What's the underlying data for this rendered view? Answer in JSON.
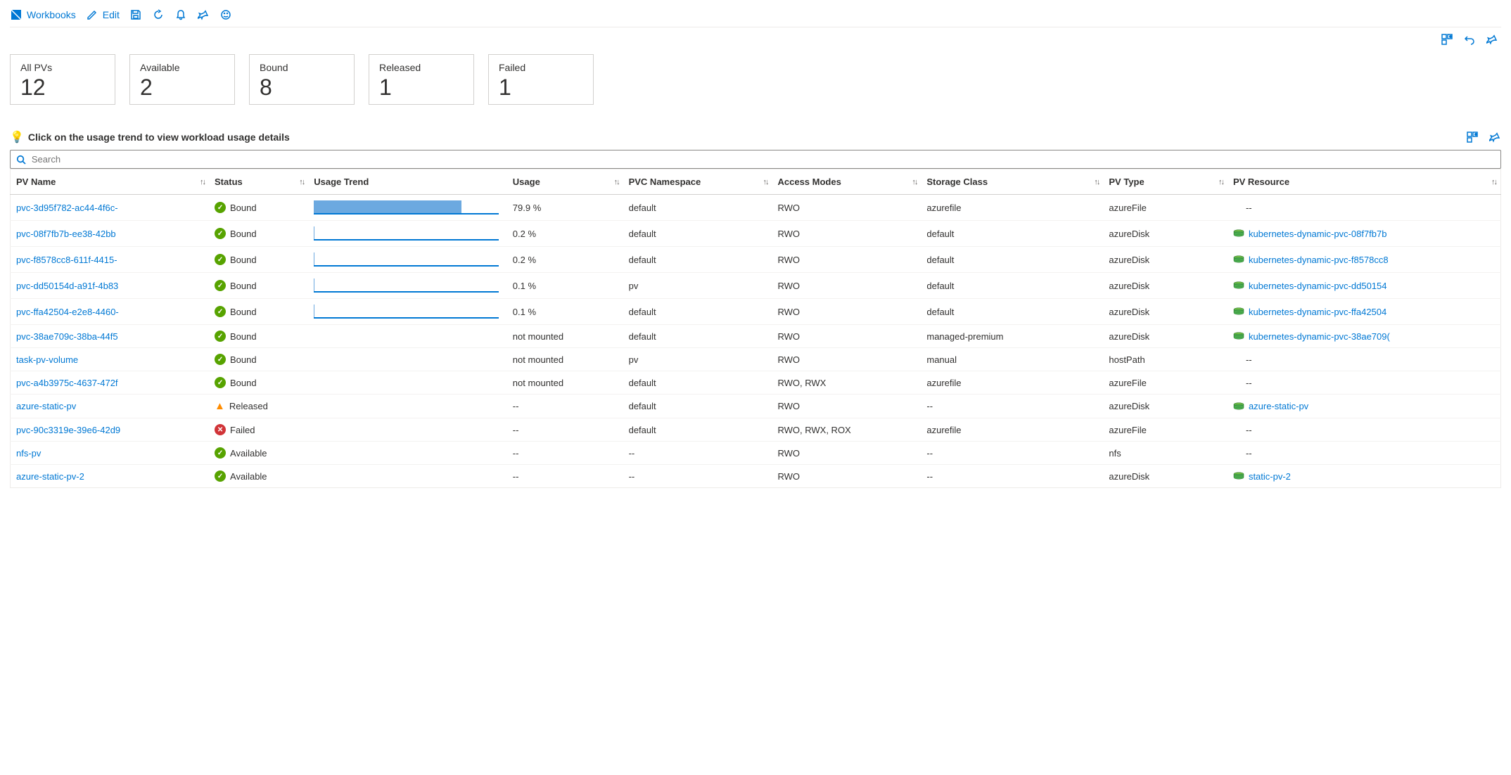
{
  "toolbar": {
    "workbooks": "Workbooks",
    "edit": "Edit"
  },
  "tiles": [
    {
      "label": "All PVs",
      "value": "12"
    },
    {
      "label": "Available",
      "value": "2"
    },
    {
      "label": "Bound",
      "value": "8"
    },
    {
      "label": "Released",
      "value": "1"
    },
    {
      "label": "Failed",
      "value": "1"
    }
  ],
  "hint": "Click on the usage trend to view workload usage details",
  "search": {
    "placeholder": "Search"
  },
  "columns": {
    "name": "PV Name",
    "status": "Status",
    "trend": "Usage Trend",
    "usage": "Usage",
    "ns": "PVC Namespace",
    "access": "Access Modes",
    "sc": "Storage Class",
    "type": "PV Type",
    "res": "PV Resource"
  },
  "rows": [
    {
      "name": "pvc-3d95f782-ac44-4f6c-",
      "status": "Bound",
      "statusKind": "ok",
      "trend": 79.9,
      "usage": "79.9 %",
      "ns": "default",
      "access": "RWO",
      "sc": "azurefile",
      "type": "azureFile",
      "res": "--",
      "resLink": false
    },
    {
      "name": "pvc-08f7fb7b-ee38-42bb",
      "status": "Bound",
      "statusKind": "ok",
      "trend": 0.2,
      "usage": "0.2 %",
      "ns": "default",
      "access": "RWO",
      "sc": "default",
      "type": "azureDisk",
      "res": "kubernetes-dynamic-pvc-08f7fb7b",
      "resLink": true
    },
    {
      "name": "pvc-f8578cc8-611f-4415-",
      "status": "Bound",
      "statusKind": "ok",
      "trend": 0.2,
      "usage": "0.2 %",
      "ns": "default",
      "access": "RWO",
      "sc": "default",
      "type": "azureDisk",
      "res": "kubernetes-dynamic-pvc-f8578cc8",
      "resLink": true
    },
    {
      "name": "pvc-dd50154d-a91f-4b83",
      "status": "Bound",
      "statusKind": "ok",
      "trend": 0.1,
      "usage": "0.1 %",
      "ns": "pv",
      "access": "RWO",
      "sc": "default",
      "type": "azureDisk",
      "res": "kubernetes-dynamic-pvc-dd50154",
      "resLink": true
    },
    {
      "name": "pvc-ffa42504-e2e8-4460-",
      "status": "Bound",
      "statusKind": "ok",
      "trend": 0.1,
      "usage": "0.1 %",
      "ns": "default",
      "access": "RWO",
      "sc": "default",
      "type": "azureDisk",
      "res": "kubernetes-dynamic-pvc-ffa42504",
      "resLink": true
    },
    {
      "name": "pvc-38ae709c-38ba-44f5",
      "status": "Bound",
      "statusKind": "ok",
      "trend": null,
      "usage": "not mounted",
      "ns": "default",
      "access": "RWO",
      "sc": "managed-premium",
      "type": "azureDisk",
      "res": "kubernetes-dynamic-pvc-38ae709(",
      "resLink": true
    },
    {
      "name": "task-pv-volume",
      "status": "Bound",
      "statusKind": "ok",
      "trend": null,
      "usage": "not mounted",
      "ns": "pv",
      "access": "RWO",
      "sc": "manual",
      "type": "hostPath",
      "res": "--",
      "resLink": false
    },
    {
      "name": "pvc-a4b3975c-4637-472f",
      "status": "Bound",
      "statusKind": "ok",
      "trend": null,
      "usage": "not mounted",
      "ns": "default",
      "access": "RWO, RWX",
      "sc": "azurefile",
      "type": "azureFile",
      "res": "--",
      "resLink": false
    },
    {
      "name": "azure-static-pv",
      "status": "Released",
      "statusKind": "warn",
      "trend": null,
      "usage": "--",
      "ns": "default",
      "access": "RWO",
      "sc": "--",
      "type": "azureDisk",
      "res": "azure-static-pv",
      "resLink": true
    },
    {
      "name": "pvc-90c3319e-39e6-42d9",
      "status": "Failed",
      "statusKind": "fail",
      "trend": null,
      "usage": "--",
      "ns": "default",
      "access": "RWO, RWX, ROX",
      "sc": "azurefile",
      "type": "azureFile",
      "res": "--",
      "resLink": false
    },
    {
      "name": "nfs-pv",
      "status": "Available",
      "statusKind": "ok",
      "trend": null,
      "usage": "--",
      "ns": "--",
      "access": "RWO",
      "sc": "--",
      "type": "nfs",
      "res": "--",
      "resLink": false
    },
    {
      "name": "azure-static-pv-2",
      "status": "Available",
      "statusKind": "ok",
      "trend": null,
      "usage": "--",
      "ns": "--",
      "access": "RWO",
      "sc": "--",
      "type": "azureDisk",
      "res": "static-pv-2",
      "resLink": true
    }
  ]
}
